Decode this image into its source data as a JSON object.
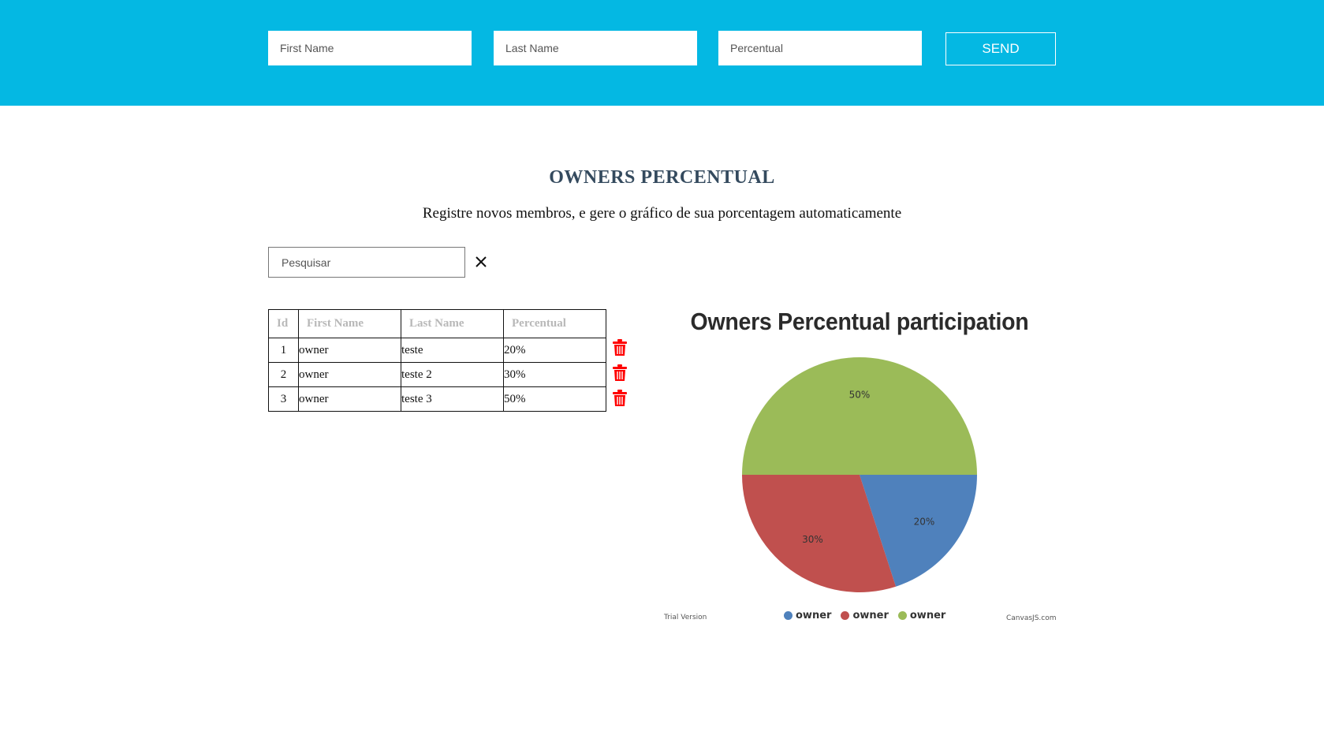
{
  "header": {
    "first_name_placeholder": "First Name",
    "last_name_placeholder": "Last Name",
    "percentual_placeholder": "Percentual",
    "send_label": "SEND"
  },
  "main": {
    "title": "OWNERS PERCENTUAL",
    "subtitle": "Registre novos membros, e gere o gráfico de sua porcentagem automaticamente"
  },
  "search": {
    "placeholder": "Pesquisar",
    "clear_icon": "close-icon"
  },
  "table": {
    "headers": [
      "Id",
      "First Name",
      "Last Name",
      "Percentual"
    ],
    "rows": [
      {
        "id": "1",
        "first_name": "owner",
        "last_name": "teste",
        "percentual": "20%"
      },
      {
        "id": "2",
        "first_name": "owner",
        "last_name": "teste 2",
        "percentual": "30%"
      },
      {
        "id": "3",
        "first_name": "owner",
        "last_name": "teste 3",
        "percentual": "50%"
      }
    ],
    "delete_icon": "trash-icon",
    "delete_color": "#ff0000"
  },
  "chart_data": {
    "type": "pie",
    "title": "Owners Percentual participation",
    "slices": [
      {
        "label": "owner",
        "value": 20,
        "display": "20%",
        "color": "#4f81bc"
      },
      {
        "label": "owner",
        "value": 30,
        "display": "30%",
        "color": "#c0504e"
      },
      {
        "label": "owner",
        "value": 50,
        "display": "50%",
        "color": "#9bbb58"
      }
    ],
    "legend_placement": "bottom"
  },
  "footer": {
    "trial_text": "Trial Version",
    "credit_text": "CanvasJS.com"
  },
  "colors": {
    "header_bg": "#04b8e3",
    "title_color": "#344a5e"
  }
}
